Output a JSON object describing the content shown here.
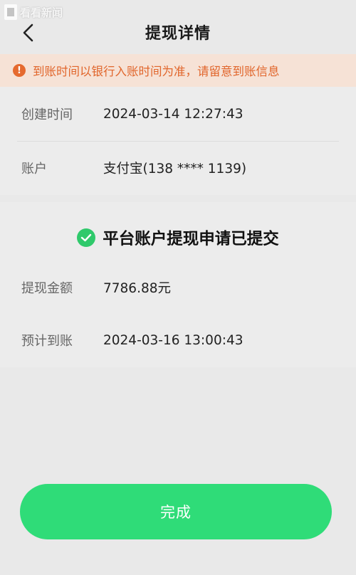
{
  "watermark": {
    "text": "看看新闻"
  },
  "header": {
    "title": "提现详情",
    "back_icon": "chevron-left-icon"
  },
  "notice": {
    "icon": "info-icon",
    "icon_glyph": "!",
    "text": "到账时间以银行入账时间为准，请留意到账信息",
    "color": "#e1662c",
    "background": "#f6e2d6"
  },
  "details": {
    "created": {
      "label": "创建时间",
      "value": "2024-03-14 12:27:43"
    },
    "account": {
      "label": "账户",
      "value": "支付宝(138 **** 1139)"
    }
  },
  "status": {
    "icon": "check-circle-icon",
    "text": "平台账户提现申请已提交",
    "color": "#2fc96b"
  },
  "withdrawal": {
    "amount": {
      "label": "提现金额",
      "value": "7786.88元"
    },
    "expected": {
      "label": "预计到账",
      "value": "2024-03-16 13:00:43"
    }
  },
  "footer": {
    "done_label": "完成",
    "button_color": "#2fdc78"
  }
}
